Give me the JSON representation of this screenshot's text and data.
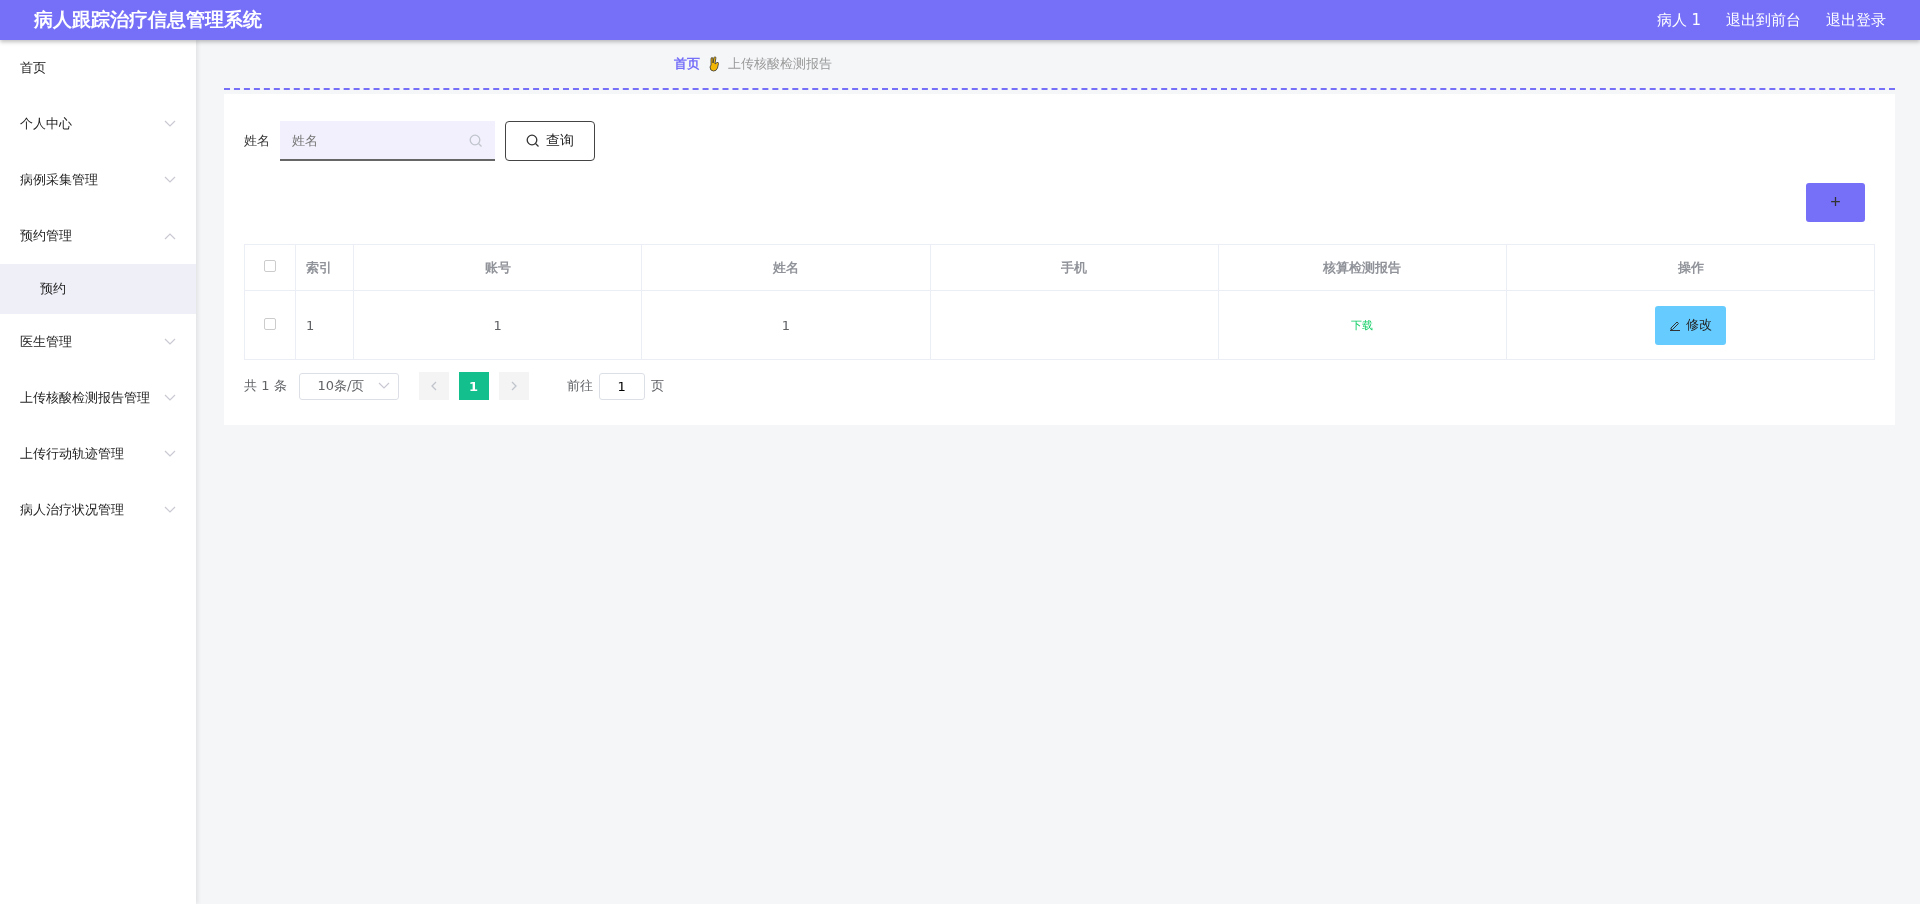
{
  "header": {
    "title": "病人跟踪治疗信息管理系统",
    "links": [
      "病人 1",
      "退出到前台",
      "退出登录"
    ]
  },
  "sidebar": {
    "items": [
      {
        "label": "首页",
        "kind": "link"
      },
      {
        "label": "个人中心",
        "kind": "menu",
        "expanded": false
      },
      {
        "label": "病例采集管理",
        "kind": "menu",
        "expanded": false
      },
      {
        "label": "预约管理",
        "kind": "menu",
        "expanded": true,
        "children": [
          {
            "label": "预约",
            "selected": true
          }
        ]
      },
      {
        "label": "医生管理",
        "kind": "menu",
        "expanded": false
      },
      {
        "label": "上传核酸检测报告管理",
        "kind": "menu",
        "expanded": false
      },
      {
        "label": "上传行动轨迹管理",
        "kind": "menu",
        "expanded": false
      },
      {
        "label": "病人治疗状况管理",
        "kind": "menu",
        "expanded": false
      }
    ]
  },
  "breadcrumb": [
    "首页",
    "上传核酸检测报告"
  ],
  "search": {
    "label": "姓名",
    "placeholder": "姓名",
    "button": "查询"
  },
  "add_button": "+",
  "table": {
    "select_all": false,
    "columns": [
      "索引",
      "账号",
      "姓名",
      "手机",
      "核算检测报告",
      "操作"
    ],
    "rows": [
      {
        "checked": false,
        "index": "1",
        "account": "1",
        "name": "1",
        "report": "下载",
        "action": "修改"
      }
    ]
  },
  "pagination": {
    "total": "共 1 条",
    "page_size": "10条/页",
    "pages": [
      {
        "label": "1",
        "selected": true
      }
    ],
    "goto_label": "前往",
    "goto_value": "1",
    "page_unit": "页"
  }
}
